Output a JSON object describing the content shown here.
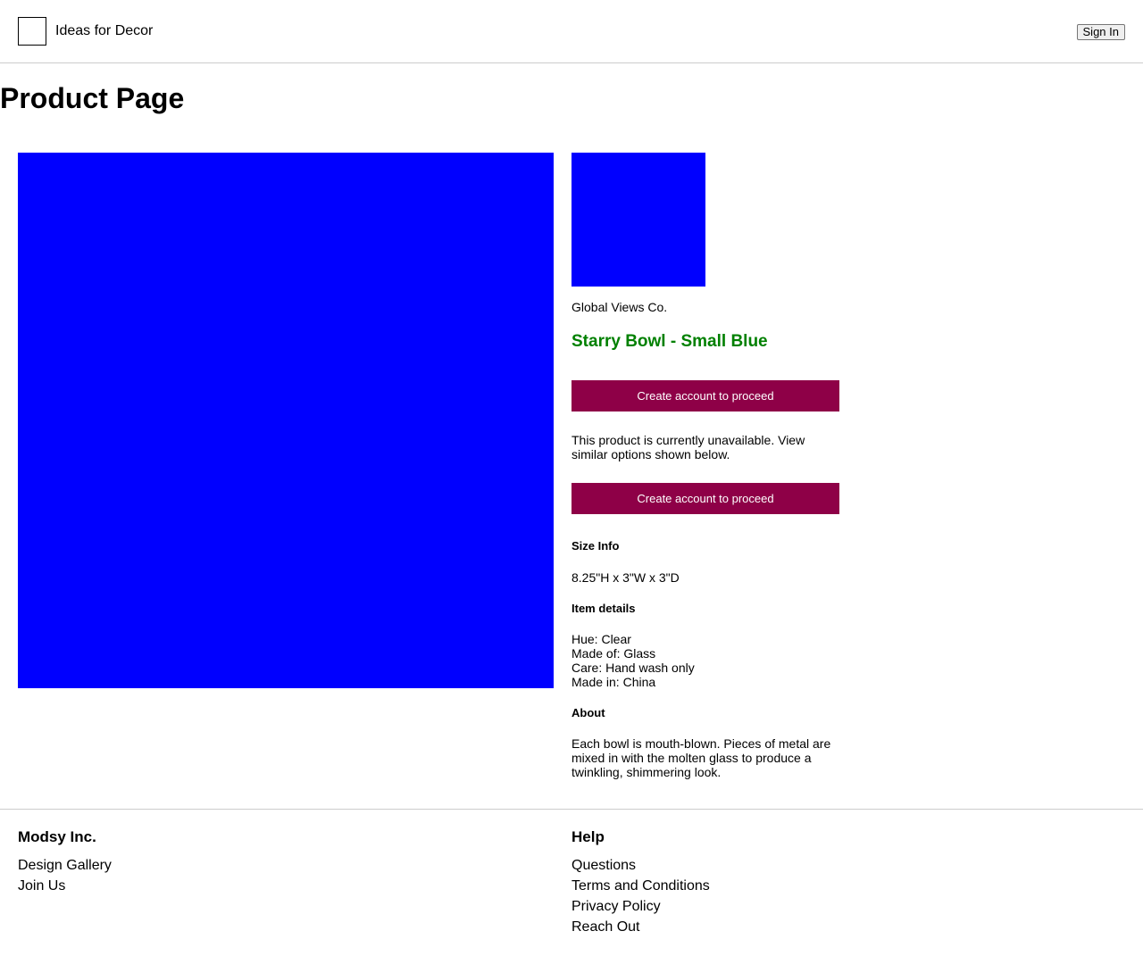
{
  "header": {
    "brand": "Ideas for Decor",
    "sign_in_label": "Sign In"
  },
  "page": {
    "title": "Product Page"
  },
  "colors": {
    "image_placeholder": "#0000ff",
    "product_name": "#008000",
    "cta_background": "#8e0047",
    "divider": "#cccccc"
  },
  "product": {
    "vendor": "Global Views Co.",
    "name": "Starry Bowl - Small Blue",
    "cta_label_1": "Create account to proceed",
    "unavailable_message": "This product is currently unavailable. View similar options shown below.",
    "cta_label_2": "Create account to proceed",
    "size_info_title": "Size Info",
    "size_info": "8.25\"H x 3\"W x 3\"D",
    "item_details_title": "Item details",
    "item_details": [
      "Hue: Clear",
      "Made of: Glass",
      "Care: Hand wash only",
      "Made in: China"
    ],
    "about_title": "About",
    "about": "Each bowl is mouth-blown. Pieces of metal are mixed in with the molten glass to produce a twinkling, shimmering look."
  },
  "footer": {
    "company": {
      "heading": "Modsy Inc.",
      "links": [
        "Design Gallery",
        "Join Us"
      ]
    },
    "help": {
      "heading": "Help",
      "links": [
        "Questions",
        "Terms and Conditions",
        "Privacy Policy",
        "Reach Out"
      ]
    }
  }
}
